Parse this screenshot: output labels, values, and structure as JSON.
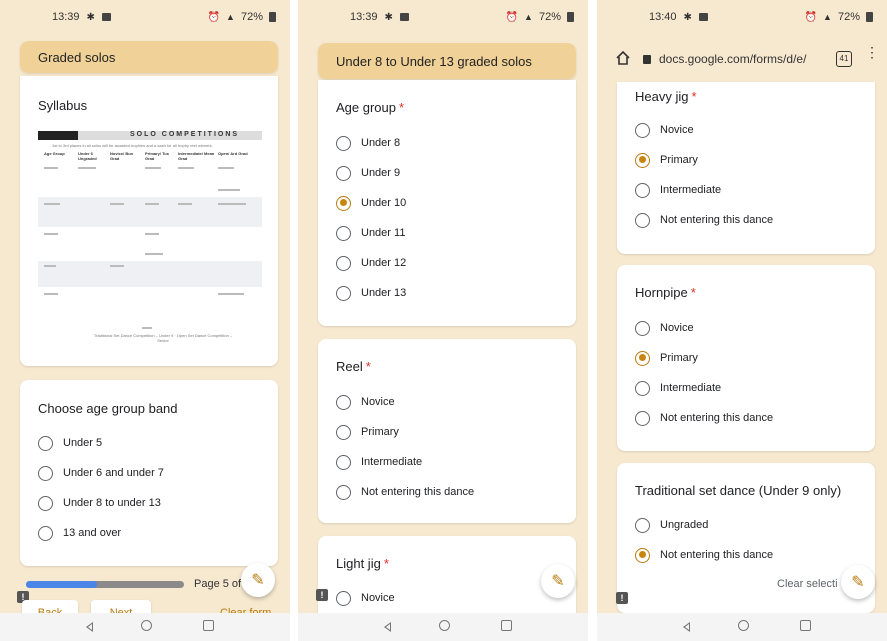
{
  "screens": [
    {
      "status": {
        "time": "13:39",
        "battery": "72%"
      },
      "section_title": "Graded solos",
      "syllabus": {
        "title": "Syllabus",
        "doc_heading": "SOLO COMPETITIONS",
        "doc_intro": "1st to 3rd places in all solos will be awarded trophies and a sash for all trophy reel winners.",
        "columns": [
          "Age Group",
          "Under 6 Ungraded",
          "Novice/ Bun Grad",
          "Primary/ Tus Grad",
          "Intermediate/ Mean Grad",
          "Open/ Ard Grad"
        ],
        "footer": "Traditional Set Dance Competition – Under 9 · Open Set Dance Competition – Senior"
      },
      "question": {
        "title": "Choose age group band",
        "options": [
          {
            "label": "Under 5",
            "selected": false
          },
          {
            "label": "Under 6 and under 7",
            "selected": false
          },
          {
            "label": "Under 8 to under 13",
            "selected": false
          },
          {
            "label": "13 and over",
            "selected": false
          }
        ]
      },
      "page_indicator": "Page 5 of",
      "progress_fraction": 0.45,
      "back_label": "Back",
      "next_label": "Next",
      "clear_label": "Clear form"
    },
    {
      "status": {
        "time": "13:39",
        "battery": "72%"
      },
      "section_title": "Under 8 to Under 13 graded solos",
      "questions": [
        {
          "title": "Age group",
          "options": [
            {
              "label": "Under 8",
              "selected": false
            },
            {
              "label": "Under 9",
              "selected": false
            },
            {
              "label": "Under 10",
              "selected": true
            },
            {
              "label": "Under 11",
              "selected": false
            },
            {
              "label": "Under 12",
              "selected": false
            },
            {
              "label": "Under 13",
              "selected": false
            }
          ]
        },
        {
          "title": "Reel",
          "options": [
            {
              "label": "Novice",
              "selected": false
            },
            {
              "label": "Primary",
              "selected": false
            },
            {
              "label": "Intermediate",
              "selected": false
            },
            {
              "label": "Not entering this dance",
              "selected": false
            }
          ]
        },
        {
          "title": "Light jig",
          "options": [
            {
              "label": "Novice",
              "selected": false
            }
          ]
        }
      ]
    },
    {
      "status": {
        "time": "13:40",
        "battery": "72%"
      },
      "url": "docs.google.com/forms/d/e/",
      "tab_count": "41",
      "questions": [
        {
          "title": "Heavy jig",
          "options": [
            {
              "label": "Novice",
              "selected": false
            },
            {
              "label": "Primary",
              "selected": true
            },
            {
              "label": "Intermediate",
              "selected": false
            },
            {
              "label": "Not entering this dance",
              "selected": false
            }
          ]
        },
        {
          "title": "Hornpipe",
          "options": [
            {
              "label": "Novice",
              "selected": false
            },
            {
              "label": "Primary",
              "selected": true
            },
            {
              "label": "Intermediate",
              "selected": false
            },
            {
              "label": "Not entering this dance",
              "selected": false
            }
          ]
        },
        {
          "title": "Traditional set dance (Under 9 only)",
          "options": [
            {
              "label": "Ungraded",
              "selected": false
            },
            {
              "label": "Not entering this dance",
              "selected": true
            }
          ]
        }
      ],
      "clear_selection_label": "Clear selecti"
    }
  ],
  "icons": {
    "required_mark": "*",
    "edit": "pencil-icon",
    "feedback": "feedback-icon",
    "feedback_glyph": "!",
    "edit_glyph": "✎",
    "kebab_glyph": "⋮"
  },
  "colors": {
    "background": "#f7e9d0",
    "header": "#f0d298",
    "accent": "#c8850f",
    "progress": "#4a86e8",
    "required": "#d93025"
  }
}
